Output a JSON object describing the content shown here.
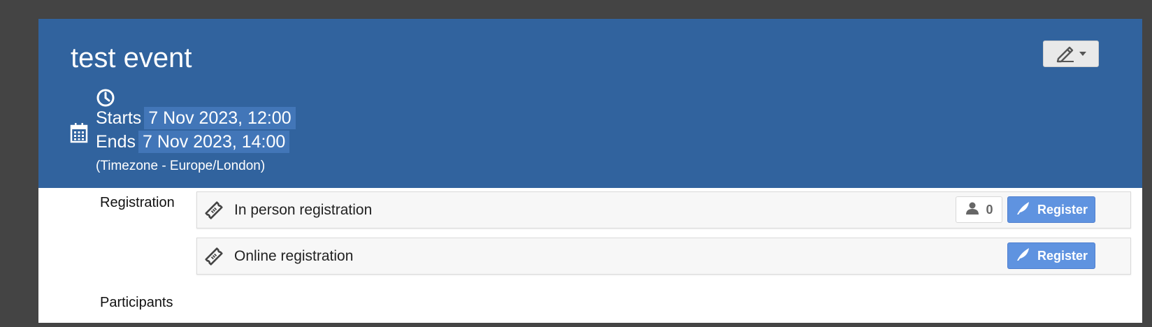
{
  "event": {
    "title": "test event",
    "starts_label": "Starts",
    "starts_value": "7 Nov 2023, 12:00",
    "ends_label": "Ends",
    "ends_value": "7 Nov 2023, 14:00",
    "timezone": "(Timezone - Europe/London)"
  },
  "icons": {
    "edit": "pencil-icon",
    "dropdown": "caret-down-icon",
    "clock": "clock-icon",
    "calendar": "calendar-icon",
    "ticket": "ticket-icon",
    "user": "user-icon",
    "register": "feather-icon"
  },
  "sections": {
    "registration_label": "Registration",
    "participants_label": "Participants"
  },
  "registrations": [
    {
      "name": "In person registration",
      "count": "0",
      "button_label": "Register"
    },
    {
      "name": "Online registration",
      "button_label": "Register"
    }
  ],
  "colors": {
    "header_bg": "#31639e",
    "time_highlight": "#4276b8",
    "register_button": "#5f93e0",
    "page_bg": "#444444"
  }
}
